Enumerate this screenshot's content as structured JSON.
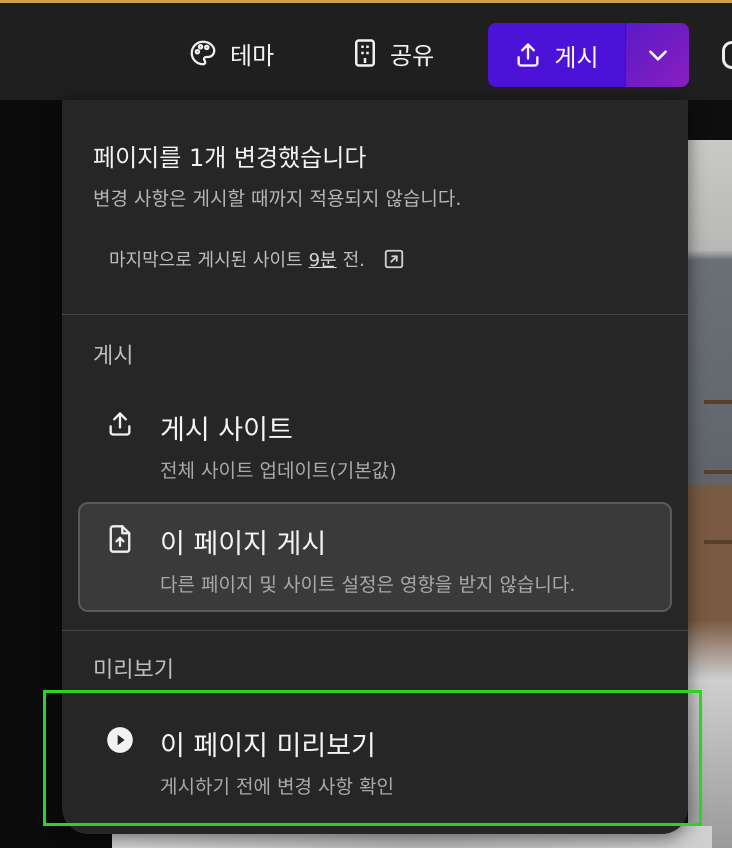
{
  "topbar": {
    "theme_label": "테마",
    "share_label": "공유",
    "publish_label": "게시"
  },
  "panel": {
    "title": "페이지를 1개 변경했습니다",
    "subtitle": "변경 사항은 게시할 때까지 적용되지 않습니다.",
    "last_published_prefix": "마지막으로 게시된 사이트",
    "last_published_time": "9분",
    "last_published_suffix": "전.",
    "publish_section_label": "게시",
    "publish_site": {
      "label": "게시 사이트",
      "description": "전체 사이트 업데이트(기본값)"
    },
    "publish_page": {
      "label": "이 페이지 게시",
      "description": "다른 페이지 및 사이트 설정은 영향을 받지 않습니다."
    },
    "preview_section_label": "미리보기",
    "preview_page": {
      "label": "이 페이지 미리보기",
      "description": "게시하기 전에 변경 사항 확인"
    }
  },
  "colors": {
    "publish_button": "#4c12d8",
    "focus_ring": "#2bd41e",
    "panel_bg": "#262626"
  },
  "icons": {
    "theme": "palette-icon",
    "share": "building-icon",
    "publish": "upload-icon",
    "open_new": "open-external-icon",
    "publish_page": "file-upload-icon",
    "preview": "play-circle-icon"
  }
}
